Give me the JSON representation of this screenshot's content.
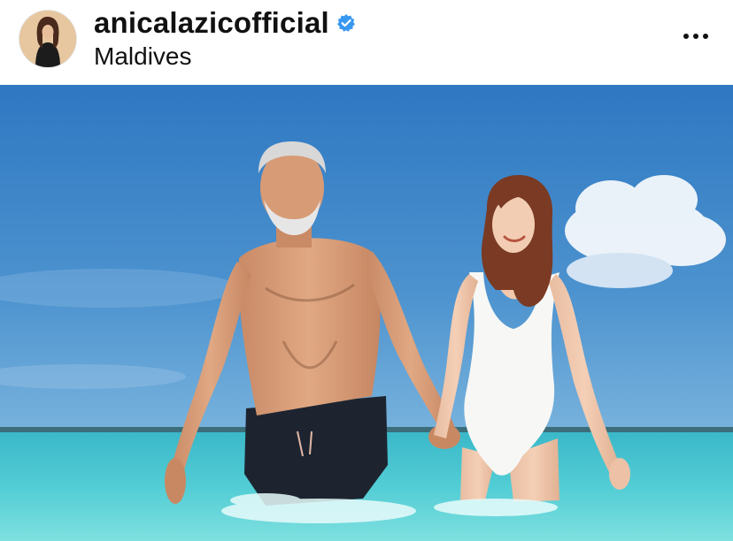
{
  "post": {
    "username": "anicalazicofficial",
    "verified": true,
    "location": "Maldives"
  },
  "icons": {
    "verified": "verified-badge-icon",
    "more": "more-options-icon"
  },
  "colors": {
    "verified_blue": "#3897f0",
    "sky": "#3f87c8",
    "sea": "#4fc9d3"
  }
}
